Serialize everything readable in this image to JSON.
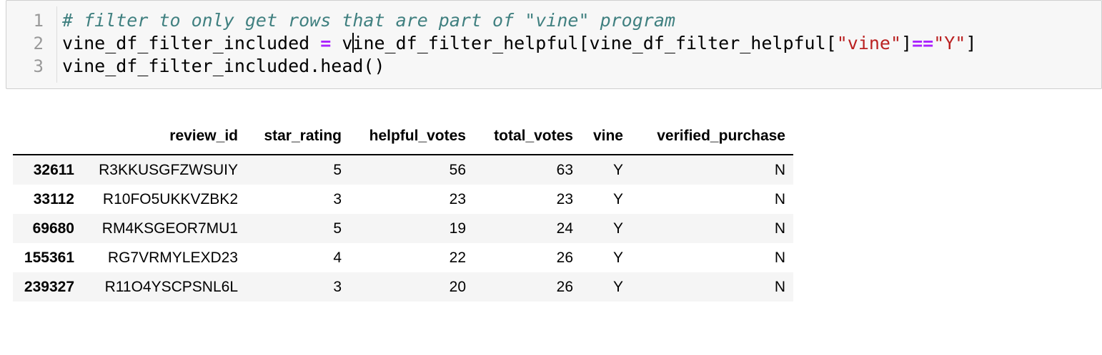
{
  "code_cell": {
    "line_numbers": [
      "1",
      "2",
      "3"
    ],
    "line1_comment": "# filter to only get rows that are part of \"vine\" program",
    "line2": {
      "lhs": "vine_df_filter_included ",
      "assign": "=",
      "rhs_start": " v",
      "rhs_rest": "ine_df_filter_helpful[vine_df_filter_helpful[",
      "str_vine": "\"vine\"",
      "close1": "]",
      "eq_op": "==",
      "str_y": "\"Y\"",
      "close2": "]"
    },
    "line3": "vine_df_filter_included.head()"
  },
  "output_table": {
    "columns": [
      "review_id",
      "star_rating",
      "helpful_votes",
      "total_votes",
      "vine",
      "verified_purchase"
    ],
    "rows": [
      {
        "index": "32611",
        "cells": [
          "R3KKUSGFZWSUIY",
          "5",
          "56",
          "63",
          "Y",
          "N"
        ]
      },
      {
        "index": "33112",
        "cells": [
          "R10FO5UKKVZBK2",
          "3",
          "23",
          "23",
          "Y",
          "N"
        ]
      },
      {
        "index": "69680",
        "cells": [
          "RM4KSGEOR7MU1",
          "5",
          "19",
          "24",
          "Y",
          "N"
        ]
      },
      {
        "index": "155361",
        "cells": [
          "RG7VRMYLEXD23",
          "4",
          "22",
          "26",
          "Y",
          "N"
        ]
      },
      {
        "index": "239327",
        "cells": [
          "R11O4YSCPSNL6L",
          "3",
          "20",
          "26",
          "Y",
          "N"
        ]
      }
    ]
  },
  "colors": {
    "comment": "#408080",
    "operator": "#aa22ff",
    "string": "#ba2121",
    "cell_background": "#f7f7f7",
    "row_stripe": "#f5f5f5"
  }
}
